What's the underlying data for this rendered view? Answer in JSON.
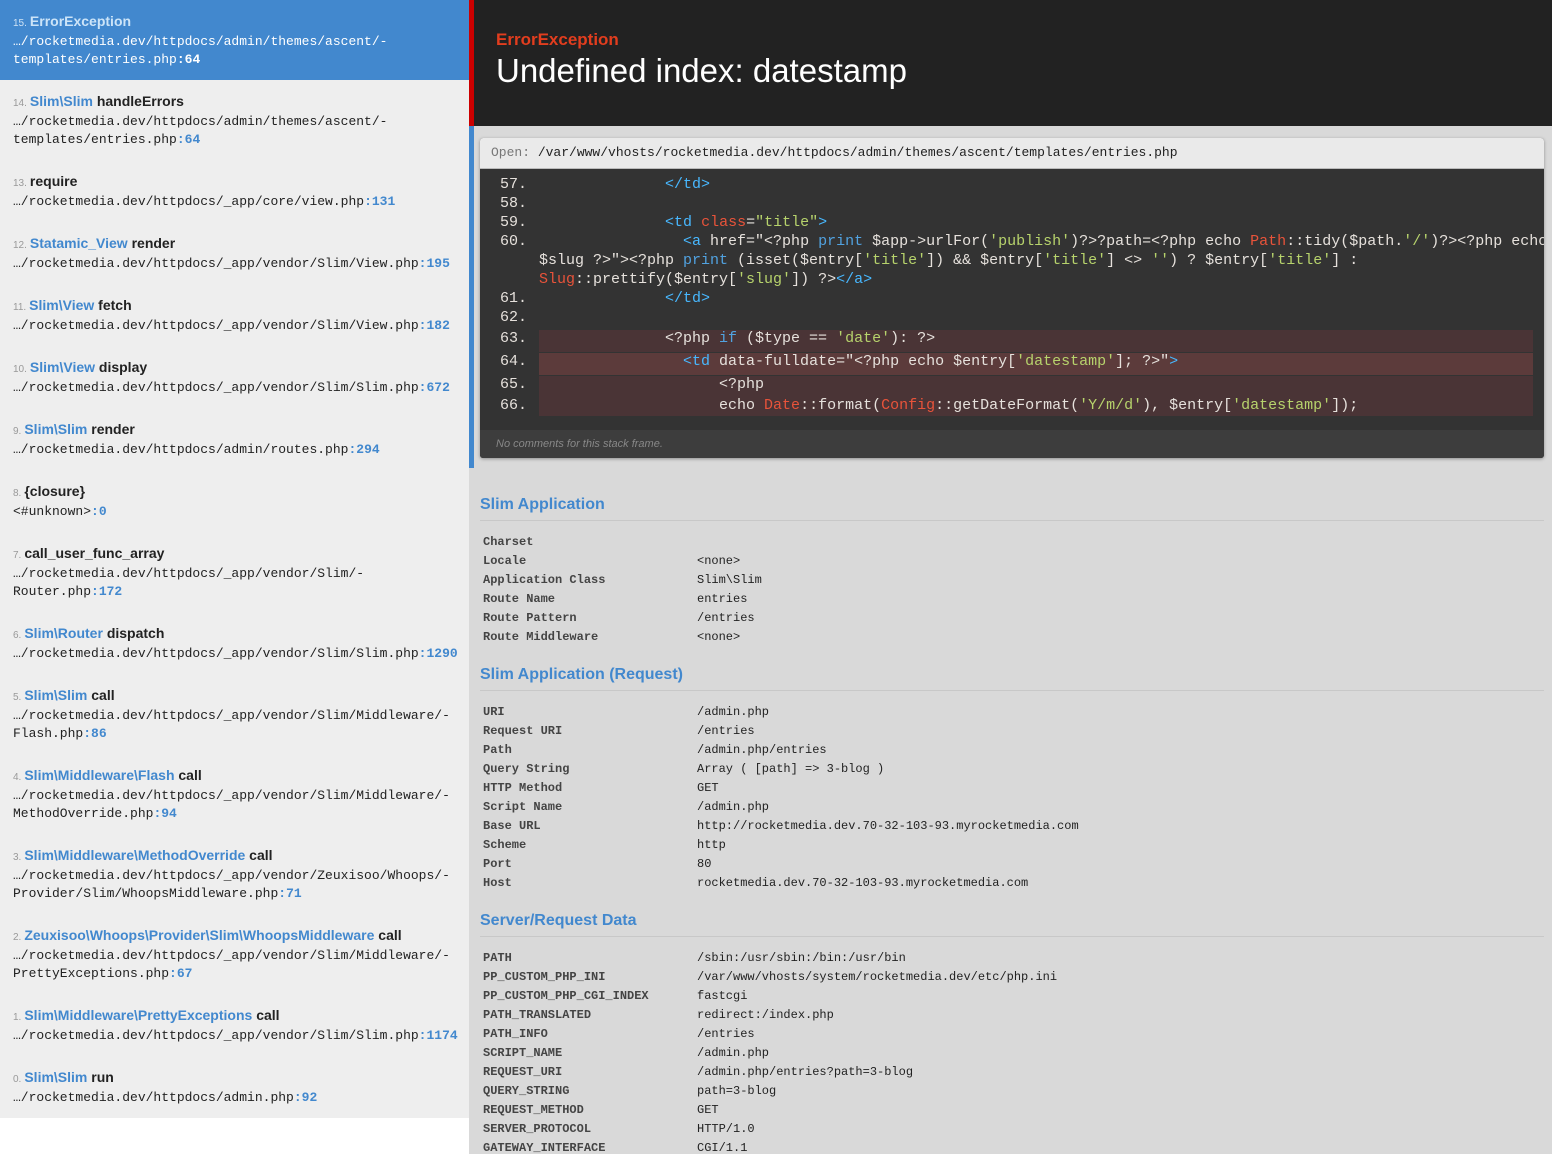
{
  "frames": [
    {
      "index": "15.",
      "class": "ErrorException",
      "func": "",
      "file": "…/rocketmedia.dev/httpdocs/admin/themes/ascent/-\ntemplates/entries.php",
      "line": "64",
      "active": true
    },
    {
      "index": "14.",
      "class": "Slim\\Slim",
      "func": "handleErrors",
      "file": "…/rocketmedia.dev/httpdocs/admin/themes/ascent/-\ntemplates/entries.php",
      "line": "64"
    },
    {
      "index": "13.",
      "class": "",
      "func": "require",
      "file": "…/rocketmedia.dev/httpdocs/_app/core/view.php",
      "line": "131"
    },
    {
      "index": "12.",
      "class": "Statamic_View",
      "func": "render",
      "file": "…/rocketmedia.dev/httpdocs/_app/vendor/Slim/View.php",
      "line": "195"
    },
    {
      "index": "11.",
      "class": "Slim\\View",
      "func": "fetch",
      "file": "…/rocketmedia.dev/httpdocs/_app/vendor/Slim/View.php",
      "line": "182"
    },
    {
      "index": "10.",
      "class": "Slim\\View",
      "func": "display",
      "file": "…/rocketmedia.dev/httpdocs/_app/vendor/Slim/Slim.php",
      "line": "672"
    },
    {
      "index": "9.",
      "class": "Slim\\Slim",
      "func": "render",
      "file": "…/rocketmedia.dev/httpdocs/admin/routes.php",
      "line": "294"
    },
    {
      "index": "8.",
      "class": "",
      "func": "{closure}",
      "file": "<#unknown>",
      "line": "0"
    },
    {
      "index": "7.",
      "class": "",
      "func": "call_user_func_array",
      "file": "…/rocketmedia.dev/httpdocs/_app/vendor/Slim/-\nRouter.php",
      "line": "172"
    },
    {
      "index": "6.",
      "class": "Slim\\Router",
      "func": "dispatch",
      "file": "…/rocketmedia.dev/httpdocs/_app/vendor/Slim/Slim.php",
      "line": "1290"
    },
    {
      "index": "5.",
      "class": "Slim\\Slim",
      "func": "call",
      "file": "…/rocketmedia.dev/httpdocs/_app/vendor/Slim/Middleware/-\nFlash.php",
      "line": "86"
    },
    {
      "index": "4.",
      "class": "Slim\\Middleware\\Flash",
      "func": "call",
      "file": "…/rocketmedia.dev/httpdocs/_app/vendor/Slim/Middleware/-\nMethodOverride.php",
      "line": "94"
    },
    {
      "index": "3.",
      "class": "Slim\\Middleware\\MethodOverride",
      "func": "call",
      "file": "…/rocketmedia.dev/httpdocs/_app/vendor/Zeuxisoo/Whoops/-\nProvider/Slim/WhoopsMiddleware.php",
      "line": "71"
    },
    {
      "index": "2.",
      "class": "Zeuxisoo\\Whoops\\Provider\\Slim\\WhoopsMiddleware",
      "func": "call",
      "file": "…/rocketmedia.dev/httpdocs/_app/vendor/Slim/Middleware/-\nPrettyExceptions.php",
      "line": "67"
    },
    {
      "index": "1.",
      "class": "Slim\\Middleware\\PrettyExceptions",
      "func": "call",
      "file": "…/rocketmedia.dev/httpdocs/_app/vendor/Slim/Slim.php",
      "line": "1174"
    },
    {
      "index": "0.",
      "class": "Slim\\Slim",
      "func": "run",
      "file": "…/rocketmedia.dev/httpdocs/admin.php",
      "line": "92"
    }
  ],
  "exception": {
    "type": "ErrorException",
    "message": "Undefined index: datestamp"
  },
  "open_label": "Open:",
  "open_path": "/var/www/vhosts/rocketmedia.dev/httpdocs/admin/themes/ascent/templates/entries.php",
  "code_line_numbers": [
    "57.",
    "58.",
    "59.",
    "60.",
    "61.",
    "62.",
    "63.",
    "64.",
    "65.",
    "66."
  ],
  "no_comments": "No comments for this stack frame.",
  "sections": [
    {
      "title": "Slim Application",
      "rows": [
        [
          "Charset",
          ""
        ],
        [
          "Locale",
          "<none>"
        ],
        [
          "Application Class",
          "Slim\\Slim"
        ],
        [
          "Route Name",
          "entries"
        ],
        [
          "Route Pattern",
          "/entries"
        ],
        [
          "Route Middleware",
          "<none>"
        ]
      ]
    },
    {
      "title": "Slim Application (Request)",
      "rows": [
        [
          "URI",
          "/admin.php"
        ],
        [
          "Request URI",
          "/entries"
        ],
        [
          "Path",
          "/admin.php/entries"
        ],
        [
          "Query String",
          "Array ( [path] => 3-blog )"
        ],
        [
          "HTTP Method",
          "GET"
        ],
        [
          "Script Name",
          "/admin.php"
        ],
        [
          "Base URL",
          "http://rocketmedia.dev.70-32-103-93.myrocketmedia.com"
        ],
        [
          "Scheme",
          "http"
        ],
        [
          "Port",
          "80"
        ],
        [
          "Host",
          "rocketmedia.dev.70-32-103-93.myrocketmedia.com"
        ]
      ]
    },
    {
      "title": "Server/Request Data",
      "rows": [
        [
          "PATH",
          "/sbin:/usr/sbin:/bin:/usr/bin"
        ],
        [
          "PP_CUSTOM_PHP_INI",
          "/var/www/vhosts/system/rocketmedia.dev/etc/php.ini"
        ],
        [
          "PP_CUSTOM_PHP_CGI_INDEX",
          "fastcgi"
        ],
        [
          "PATH_TRANSLATED",
          "redirect:/index.php"
        ],
        [
          "PATH_INFO",
          "/entries"
        ],
        [
          "SCRIPT_NAME",
          "/admin.php"
        ],
        [
          "REQUEST_URI",
          "/admin.php/entries?path=3-blog"
        ],
        [
          "QUERY_STRING",
          "path=3-blog"
        ],
        [
          "REQUEST_METHOD",
          "GET"
        ],
        [
          "SERVER_PROTOCOL",
          "HTTP/1.0"
        ],
        [
          "GATEWAY_INTERFACE",
          "CGI/1.1"
        ]
      ]
    }
  ],
  "colors": {
    "accent": "#4288ce",
    "error": "#e23d1e",
    "header_bg": "#222222",
    "code_bg": "#333333"
  }
}
